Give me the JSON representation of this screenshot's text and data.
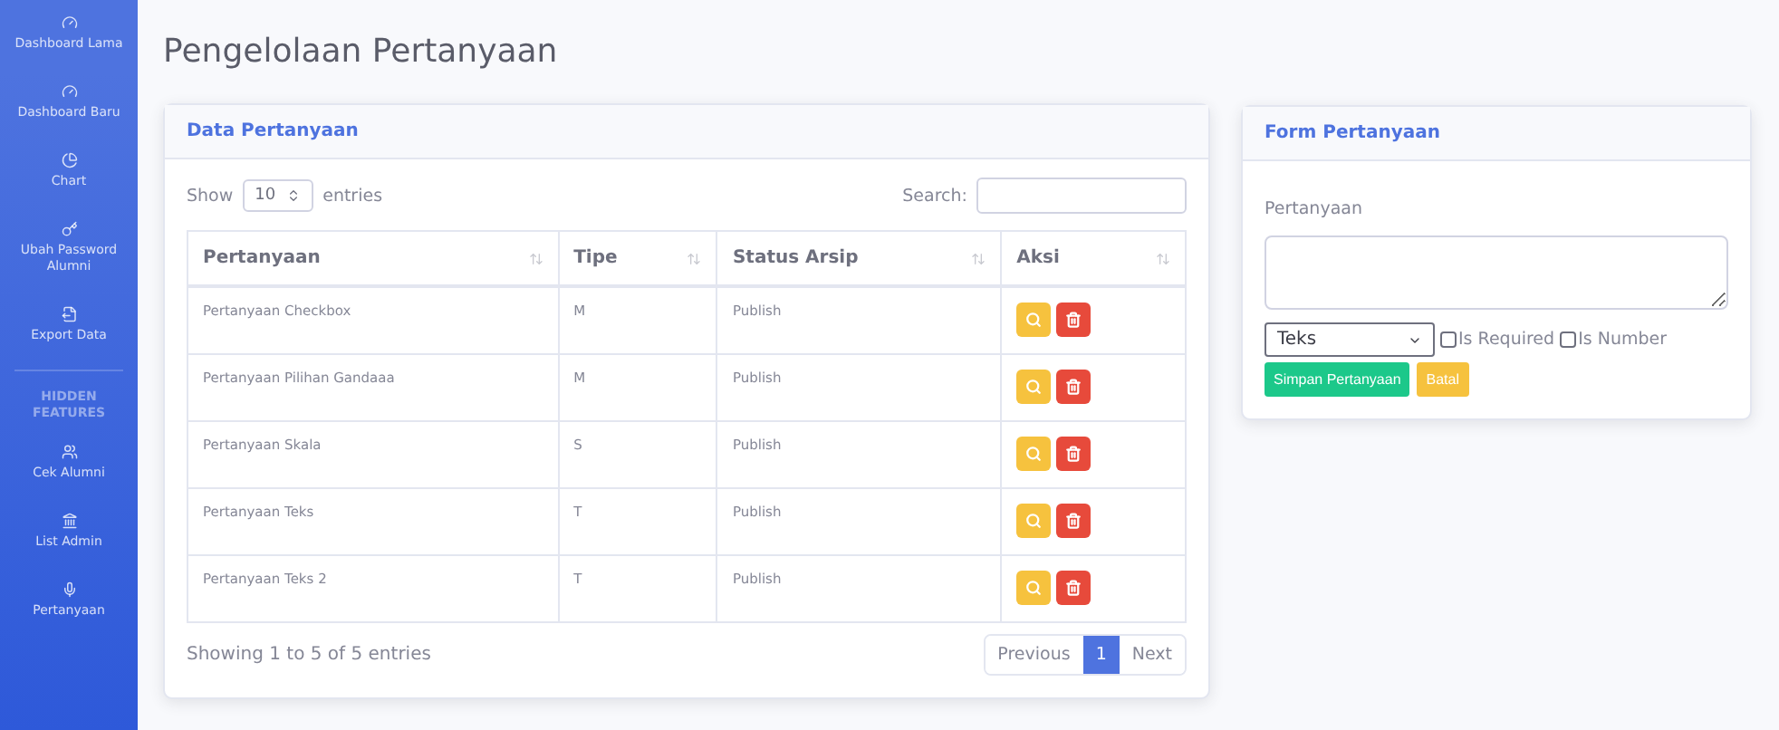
{
  "sidebar": {
    "items": [
      {
        "label": "Dashboard Lama",
        "kind": "link"
      },
      {
        "label": "Dashboard Baru",
        "kind": "link"
      },
      {
        "label": "Chart",
        "kind": "link"
      },
      {
        "label": "Ubah Password Alumni",
        "kind": "link"
      },
      {
        "label": "Export Data",
        "kind": "link"
      },
      {
        "label": "HIDDEN FEATURES",
        "kind": "heading"
      },
      {
        "label": "Cek Alumni",
        "kind": "link"
      },
      {
        "label": "List Admin",
        "kind": "link"
      },
      {
        "label": "Pertanyaan",
        "kind": "link"
      }
    ]
  },
  "page_title": "Pengelolaan Pertanyaan",
  "data_card": {
    "title": "Data Pertanyaan",
    "show_label": "Show",
    "entries_value": "10",
    "entries_label": "entries",
    "search_label": "Search:",
    "table": {
      "columns": [
        "Pertanyaan",
        "Tipe",
        "Status Arsip",
        "Aksi"
      ],
      "rows": [
        [
          "Pertanyaan Checkbox",
          "M",
          "Publish"
        ],
        [
          "Pertanyaan Pilihan Gandaaa",
          "M",
          "Publish"
        ],
        [
          "Pertanyaan Skala",
          "S",
          "Publish"
        ],
        [
          "Pertanyaan Teks",
          "T",
          "Publish"
        ],
        [
          "Pertanyaan Teks 2",
          "T",
          "Publish"
        ]
      ]
    },
    "info": "Showing 1 to 5 of 5 entries",
    "pagination": [
      {
        "label": "Previous",
        "selected": false
      },
      {
        "label": "1",
        "selected": true
      },
      {
        "label": "Next",
        "selected": false
      }
    ]
  },
  "form_card": {
    "title": "Form Pertanyaan",
    "field_label": "Pertanyaan",
    "type_value": "Teks",
    "checkboxes": [
      {
        "label": "Is Required",
        "checked": false
      },
      {
        "label": "Is Number",
        "checked": false
      }
    ],
    "buttons": [
      {
        "label": "Simpan Pertanyaan",
        "kind": "save"
      },
      {
        "label": "Batal",
        "kind": "cancel"
      }
    ]
  }
}
